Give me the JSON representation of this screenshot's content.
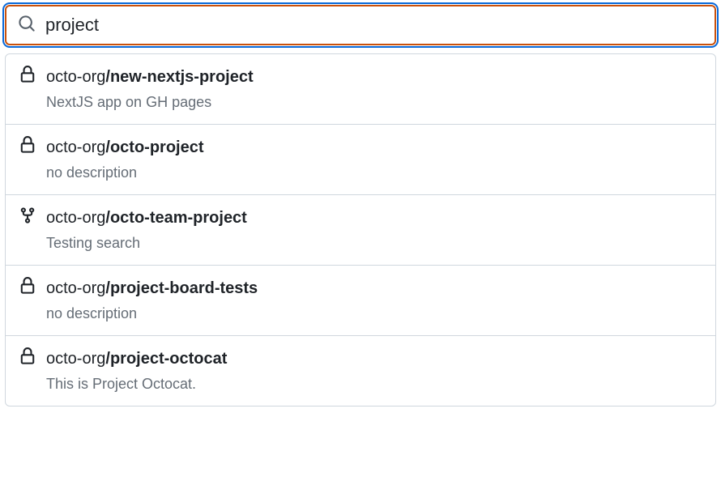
{
  "search": {
    "value": "project",
    "placeholder": ""
  },
  "results": [
    {
      "icon": "lock",
      "owner": "octo-org",
      "repo": "new-nextjs-project",
      "description": "NextJS app on GH pages"
    },
    {
      "icon": "lock",
      "owner": "octo-org",
      "repo": "octo-project",
      "description": "no description"
    },
    {
      "icon": "fork",
      "owner": "octo-org",
      "repo": "octo-team-project",
      "description": "Testing search"
    },
    {
      "icon": "lock",
      "owner": "octo-org",
      "repo": "project-board-tests",
      "description": "no description"
    },
    {
      "icon": "lock",
      "owner": "octo-org",
      "repo": "project-octocat",
      "description": "This is Project Octocat."
    }
  ]
}
